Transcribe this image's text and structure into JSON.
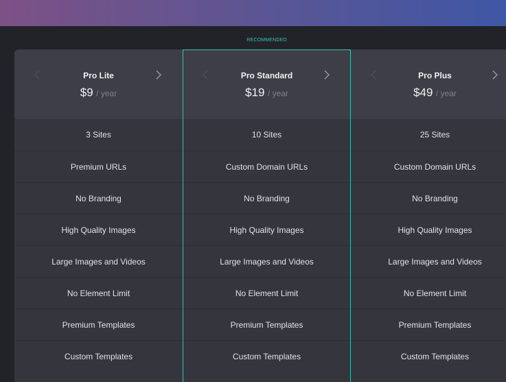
{
  "recommended_label": "RECOMMENDED",
  "colors": {
    "accent": "#3ec2ac",
    "banner_start": "#7c5186",
    "banner_end": "#3f57a6",
    "table_bg": "#34353d",
    "header_bg": "#3d3e47",
    "page_bg": "#222329"
  },
  "plans": [
    {
      "name": "Pro Lite",
      "price": "$9",
      "period": "/ year",
      "recommended": false,
      "features": [
        "3 Sites",
        "Premium URLs",
        "No Branding",
        "High Quality Images",
        "Large Images and Videos",
        "No Element Limit",
        "Premium Templates",
        "Custom Templates"
      ]
    },
    {
      "name": "Pro Standard",
      "price": "$19",
      "period": "/ year",
      "recommended": true,
      "features": [
        "10 Sites",
        "Custom Domain URLs",
        "No Branding",
        "High Quality Images",
        "Large Images and Videos",
        "No Element Limit",
        "Premium Templates",
        "Custom Templates"
      ]
    },
    {
      "name": "Pro Plus",
      "price": "$49",
      "period": "/ year",
      "recommended": false,
      "features": [
        "25 Sites",
        "Custom Domain URLs",
        "No Branding",
        "High Quality Images",
        "Large Images and Videos",
        "No Element Limit",
        "Premium Templates",
        "Custom Templates"
      ]
    }
  ],
  "icons": {
    "prev": "chevron-left-icon",
    "next": "chevron-right-icon"
  }
}
